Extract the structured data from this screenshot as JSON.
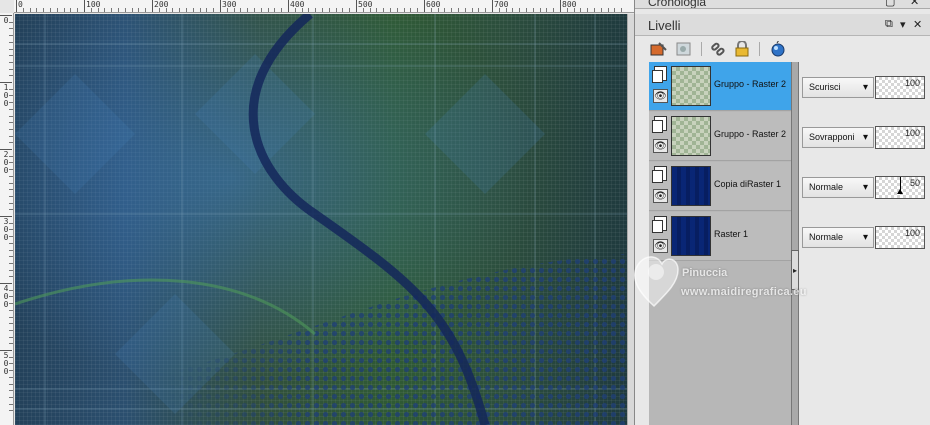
{
  "history_panel": {
    "title": "Cronologia"
  },
  "layers_panel": {
    "title": "Livelli",
    "layers": [
      {
        "name": "Gruppo - Raster 2",
        "blend_mode": "Scurisci",
        "opacity": "100",
        "selected": true
      },
      {
        "name": "Gruppo - Raster 2",
        "blend_mode": "Sovrapponi",
        "opacity": "100",
        "selected": false
      },
      {
        "name": "Copia diRaster 1",
        "blend_mode": "Normale",
        "opacity": "50",
        "selected": false
      },
      {
        "name": "Raster 1",
        "blend_mode": "Normale",
        "opacity": "100",
        "selected": false
      }
    ]
  },
  "ruler": {
    "top_labels": [
      "0",
      "100",
      "200",
      "300",
      "400",
      "500",
      "600",
      "700",
      "800"
    ],
    "left_labels": [
      "0",
      "1\n0\n0",
      "2\n0\n0",
      "3\n0\n0",
      "4\n0\n0",
      "5\n0\n0"
    ]
  },
  "watermark": {
    "name": "Pinuccia",
    "url": "www.maidiregrafica.eu"
  },
  "colors": {
    "selection": "#3fa4ea",
    "canvas_green": "#2f5a34",
    "canvas_blue": "#2b4f6f"
  },
  "icons": [
    "new-layer-icon",
    "mask-icon",
    "link-icon",
    "lock-icon",
    "layer-styles-icon",
    "visibility-eye-icon",
    "page-icon"
  ]
}
